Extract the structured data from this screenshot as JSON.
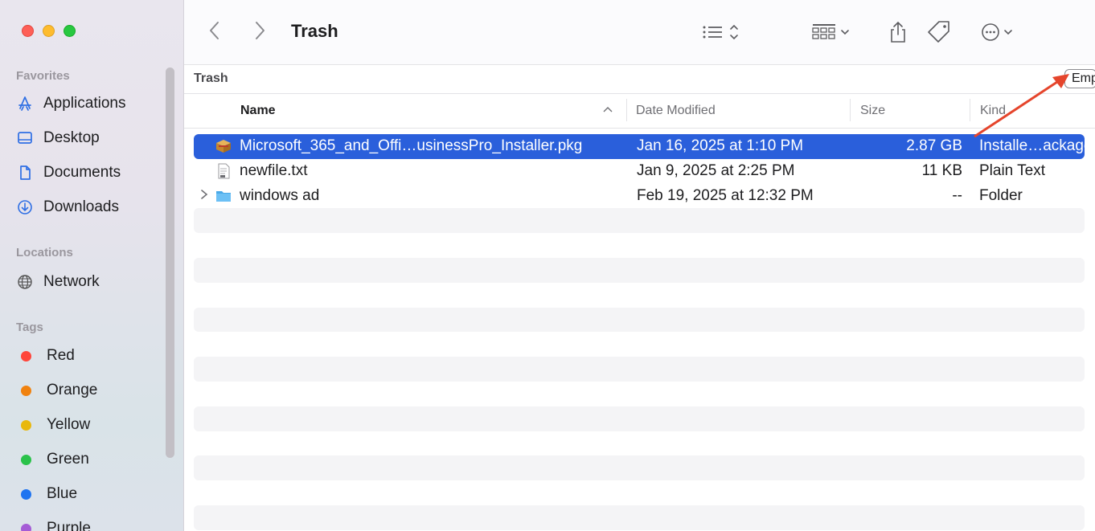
{
  "sidebar": {
    "sections": {
      "favorites": "Favorites",
      "locations": "Locations",
      "tags": "Tags"
    },
    "favorites": [
      {
        "label": "Applications",
        "icon": "applications-icon"
      },
      {
        "label": "Desktop",
        "icon": "desktop-icon"
      },
      {
        "label": "Documents",
        "icon": "documents-icon"
      },
      {
        "label": "Downloads",
        "icon": "downloads-icon"
      }
    ],
    "locations": [
      {
        "label": "Network",
        "icon": "network-icon"
      }
    ],
    "tags": [
      {
        "label": "Red",
        "color": "#ff453a"
      },
      {
        "label": "Orange",
        "color": "#f0820f"
      },
      {
        "label": "Yellow",
        "color": "#e8b80d"
      },
      {
        "label": "Green",
        "color": "#2ac24a"
      },
      {
        "label": "Blue",
        "color": "#1f74f0"
      },
      {
        "label": "Purple",
        "color": "#a55cd6"
      }
    ]
  },
  "toolbar": {
    "title": "Trash",
    "icons": [
      "back-icon",
      "forward-icon",
      "list-view-icon",
      "group-icon",
      "share-icon",
      "tag-icon",
      "more-icon"
    ]
  },
  "pathbar": {
    "label": "Trash",
    "empty_button": "Empty"
  },
  "columns": {
    "name": "Name",
    "date": "Date Modified",
    "size": "Size",
    "kind": "Kind"
  },
  "files": [
    {
      "name": "Microsoft_365_and_Offi…usinessPro_Installer.pkg",
      "date": "Jan 16, 2025 at 1:10 PM",
      "size": "2.87 GB",
      "kind": "Installe…ackage",
      "icon": "package-icon",
      "selected": true
    },
    {
      "name": "newfile.txt",
      "date": "Jan 9, 2025 at 2:25 PM",
      "size": "11 KB",
      "kind": "Plain Text",
      "icon": "text-file-icon",
      "selected": false
    },
    {
      "name": "windows ad",
      "date": "Feb 19, 2025 at 12:32 PM",
      "size": "--",
      "kind": "Folder",
      "icon": "folder-icon",
      "selected": false
    }
  ],
  "colors": {
    "selection": "#2a5fdb",
    "annotation_arrow": "#e5452c"
  }
}
